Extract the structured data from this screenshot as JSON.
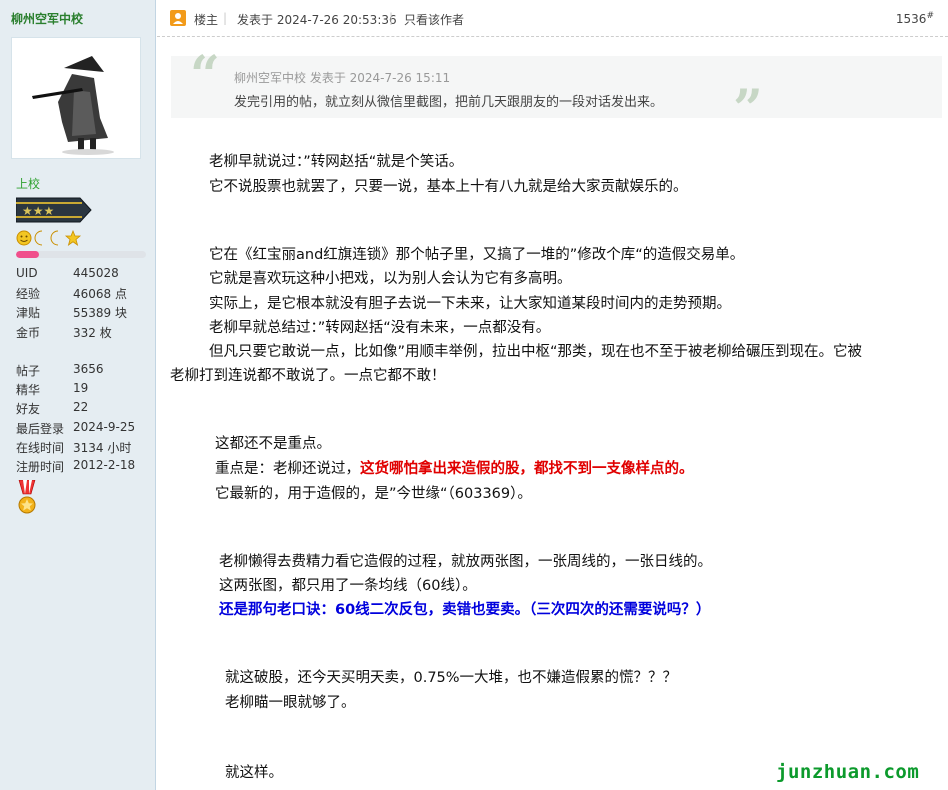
{
  "sidebar": {
    "username": "柳州空军中校",
    "rank_title": "上校",
    "level_progress": 0.18,
    "stats_group1": [
      {
        "key": "UID",
        "value": "445028"
      },
      {
        "key": "经验",
        "value": "46068 点"
      },
      {
        "key": "津贴",
        "value": "55389 块"
      },
      {
        "key": "金币",
        "value": "332 枚"
      }
    ],
    "stats_group2": [
      {
        "key": "帖子",
        "value": "3656"
      },
      {
        "key": "精华",
        "value": "19"
      },
      {
        "key": "好友",
        "value": "22"
      },
      {
        "key": "最后登录",
        "value": "2024-9-25"
      },
      {
        "key": "在线时间",
        "value": "3134 小时"
      },
      {
        "key": "注册时间",
        "value": "2012-2-18"
      }
    ]
  },
  "post_header": {
    "owner_label": "楼主",
    "posted_at": "发表于 2024-7-26 20:53:36",
    "only_author_link": "只看该作者",
    "floor": "1536",
    "floor_sup": "#"
  },
  "quote": {
    "meta": "柳州空军中校 发表于 2024-7-26 15:11",
    "body": "发完引用的帖，就立刻从微信里截图，把前几天跟朋友的一段对话发出来。"
  },
  "body": {
    "p1": "老柳早就说过：”转网赵括“就是个笑话。",
    "p2": "它不说股票也就罢了，只要一说，基本上十有八九就是给大家贡献娱乐的。",
    "p3": "它在《红宝丽and红旗连锁》那个帖子里，又搞了一堆的”修改个库“的造假交易单。",
    "p4": "它就是喜欢玩这种小把戏，以为别人会认为它有多高明。",
    "p5": "实际上，是它根本就没有胆子去说一下未来，让大家知道某段时间内的走势预期。",
    "p6": "老柳早就总结过：”转网赵括“没有未来，一点都没有。",
    "p7a": "但凡只要它敢说一点，比如像”用顺丰举例，拉出中枢“那类，现在也不至于被老柳给碾压到现在。它被",
    "p7b": "老柳打到连说都不敢说了。一点它都不敢！",
    "p8": "这都还不是重点。",
    "p9_prefix": "重点是：老柳还说过，",
    "p9_red": "这货哪怕拿出来造假的股，都找不到一支像样点的。",
    "p10": "它最新的，用于造假的，是”今世缘“（603369）。",
    "p11": "老柳懒得去费精力看它造假的过程，就放两张图，一张周线的，一张日线的。",
    "p12": "这两张图，都只用了一条均线（60线）。",
    "p13_blue": "还是那句老口诀：60线二次反包，卖错也要卖。（三次四次的还需要说吗？）",
    "p14": "就这破股，还今天买明天卖，0.75%一大堆，也不嫌造假累的慌？？？",
    "p15": "老柳瞄一眼就够了。",
    "p16": "就这样。"
  },
  "watermark": "junzhuan.com",
  "colors": {
    "sidebar_bg": "#e5edf2",
    "username": "#2a7f2e",
    "highlight_red": "#e00000",
    "highlight_blue": "#0000dd",
    "watermark": "#0c9a2c"
  }
}
